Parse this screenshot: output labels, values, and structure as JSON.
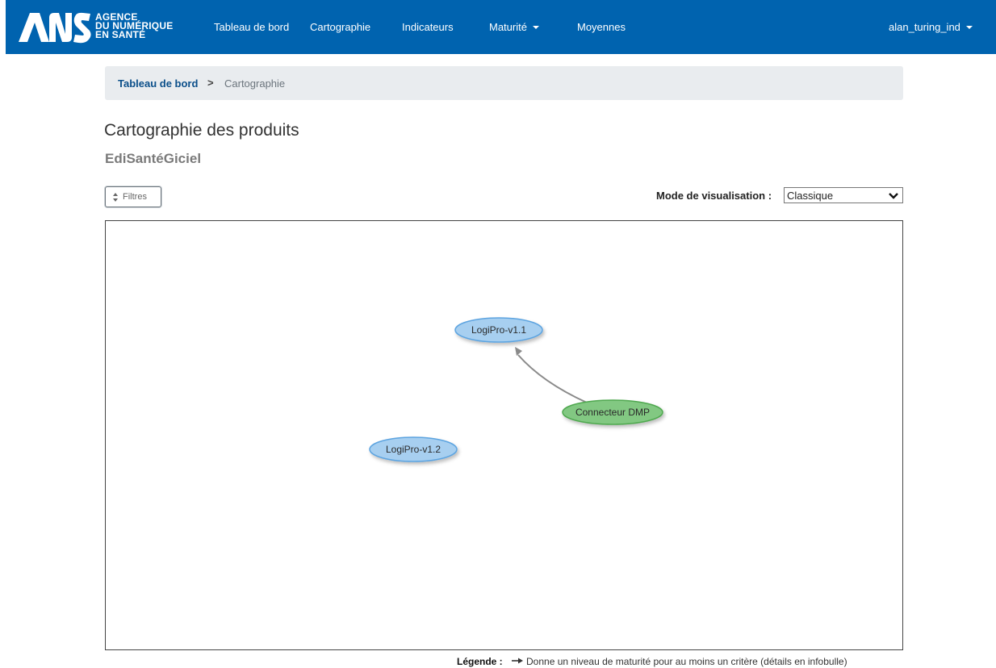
{
  "header": {
    "logo_lines": [
      "AGENCE",
      "DU NUMÉRIQUE",
      "EN SANTÉ"
    ],
    "nav": [
      {
        "label": "Tableau de bord",
        "dropdown": false
      },
      {
        "label": "Cartographie",
        "dropdown": false
      },
      {
        "label": "Indicateurs",
        "dropdown": false
      },
      {
        "label": "Maturité",
        "dropdown": true
      },
      {
        "label": "Moyennes",
        "dropdown": false
      }
    ],
    "user": "alan_turing_ind",
    "brand_color": "#0063af"
  },
  "breadcrumb": {
    "home": "Tableau de bord",
    "separator": ">",
    "current": "Cartographie"
  },
  "page": {
    "title": "Cartographie des produits",
    "subtitle": "EdiSantéGiciel"
  },
  "filters": {
    "button_label": "Filtres",
    "icon": "sort-icon"
  },
  "visualisation": {
    "label": "Mode de visualisation :",
    "selected": "Classique"
  },
  "graph": {
    "nodes": [
      {
        "id": "n1",
        "label": "LogiPro-v1.1",
        "color": "#a7cff0",
        "stroke": "#5da4e0"
      },
      {
        "id": "n2",
        "label": "Connecteur DMP",
        "color": "#82c882",
        "stroke": "#4fa84f"
      },
      {
        "id": "n3",
        "label": "LogiPro-v1.2",
        "color": "#a7cff0",
        "stroke": "#5da4e0"
      }
    ],
    "edges": [
      {
        "from": "n2",
        "to": "n1"
      }
    ]
  },
  "legend": {
    "label": "Légende :",
    "text": "Donne un niveau de maturité pour au moins un critère (détails en infobulle)"
  }
}
